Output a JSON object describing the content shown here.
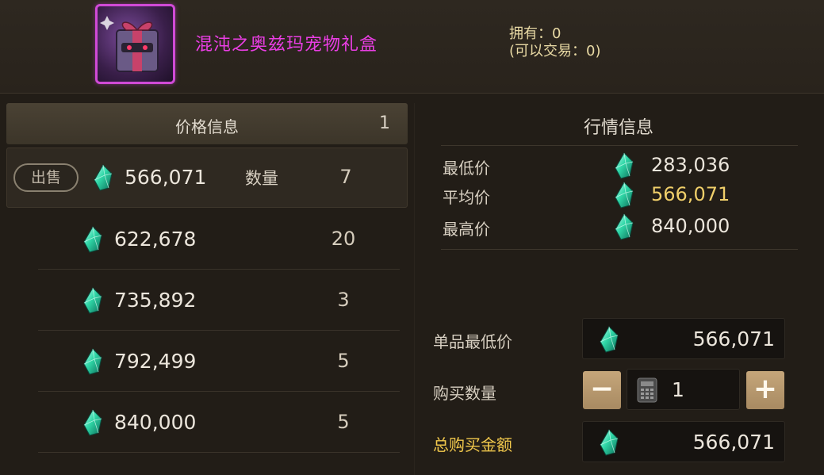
{
  "item": {
    "name": "混沌之奥兹玛宠物礼盒",
    "owned": "拥有：0",
    "tradable": "(可以交易：0)",
    "icon": "pet-gift-box-icon"
  },
  "price_panel": {
    "title": "价格信息",
    "page": "1",
    "sell_label": "出售",
    "qty_label": "数量",
    "listings": [
      {
        "price": "566,071",
        "qty": "7"
      },
      {
        "price": "622,678",
        "qty": "20"
      },
      {
        "price": "735,892",
        "qty": "3"
      },
      {
        "price": "792,499",
        "qty": "5"
      },
      {
        "price": "840,000",
        "qty": "5"
      }
    ]
  },
  "market": {
    "title": "行情信息",
    "min_label": "最低价",
    "min_value": "283,036",
    "avg_label": "平均价",
    "avg_value": "566,071",
    "max_label": "最高价",
    "max_value": "840,000"
  },
  "purchase": {
    "unit_min_label": "单品最低价",
    "unit_min_value": "566,071",
    "qty_label": "购买数量",
    "qty_value": "1",
    "minus": "−",
    "plus": "+",
    "total_label": "总购买金额",
    "total_value": "566,071"
  },
  "colors": {
    "item_name": "#ea3ee4",
    "average_price": "#f0cf6a",
    "total_label": "#f2c94c",
    "gem": "#2fd6a6"
  }
}
